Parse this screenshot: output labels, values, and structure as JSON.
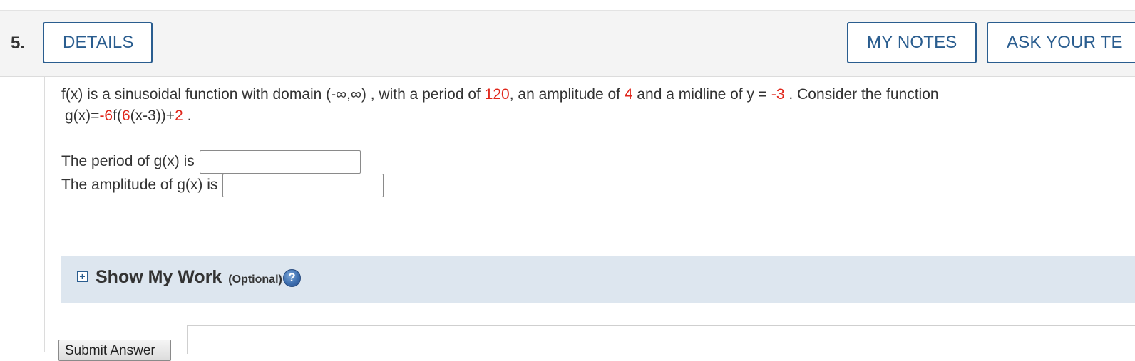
{
  "question": {
    "number": "5."
  },
  "header": {
    "details_label": "DETAILS",
    "my_notes_label": "MY NOTES",
    "ask_teacher_label": "ASK YOUR TE"
  },
  "problem": {
    "intro": "f(x) is a sinusoidal function with domain  (-∞,∞) , with a period of ",
    "period": "120",
    "mid1": ", an amplitude of ",
    "amplitude": "4",
    "mid2": " and a midline of  y = ",
    "midline": "-3",
    "mid3": " . Consider the function",
    "g_prefix": "g(x)=",
    "g_coef": "-6",
    "g_f_open": "f(",
    "g_inner_coef": "6",
    "g_inner_rest": "(x-3))+",
    "g_shift": "2",
    "g_end": " ."
  },
  "answers": {
    "period_label": "The period of g(x) is",
    "period_value": "",
    "amplitude_label": "The amplitude of g(x) is",
    "amplitude_value": ""
  },
  "show_work": {
    "expand_symbol": "+",
    "title": "Show My Work",
    "optional": "(Optional)",
    "help_symbol": "?"
  },
  "submit": {
    "label": "Submit Answer"
  },
  "colors": {
    "accent": "#2a5d8f",
    "highlight": "#e0261b",
    "work_bar": "#dde6ef",
    "header_bg": "#f4f4f4"
  }
}
